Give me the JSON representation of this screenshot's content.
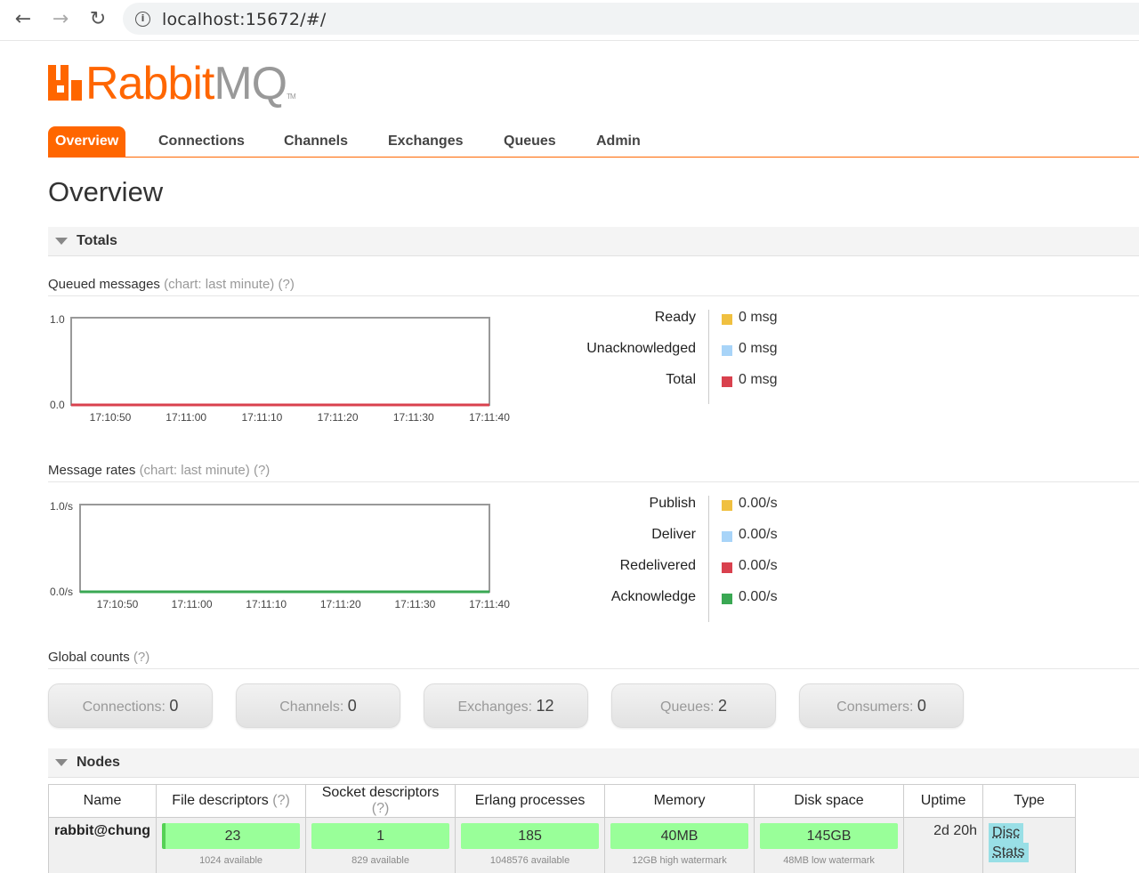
{
  "browser": {
    "url": "localhost:15672/#/"
  },
  "logo": {
    "brand_rabbit": "Rabbit",
    "brand_mq": "MQ",
    "tm": "TM"
  },
  "tabs": [
    {
      "label": "Overview",
      "active": true
    },
    {
      "label": "Connections"
    },
    {
      "label": "Channels"
    },
    {
      "label": "Exchanges"
    },
    {
      "label": "Queues"
    },
    {
      "label": "Admin"
    }
  ],
  "page_title": "Overview",
  "totals": {
    "header": "Totals",
    "queued": {
      "title": "Queued messages",
      "chart_note": "(chart: last minute)",
      "help": "(?)",
      "legend": [
        {
          "label": "Ready",
          "value": "0 msg",
          "color": "#f0c040"
        },
        {
          "label": "Unacknowledged",
          "value": "0 msg",
          "color": "#a8d4f8"
        },
        {
          "label": "Total",
          "value": "0 msg",
          "color": "#d9414e"
        }
      ]
    },
    "rates": {
      "title": "Message rates",
      "chart_note": "(chart: last minute)",
      "help": "(?)",
      "legend": [
        {
          "label": "Publish",
          "value": "0.00/s",
          "color": "#f0c040"
        },
        {
          "label": "Deliver",
          "value": "0.00/s",
          "color": "#a8d4f8"
        },
        {
          "label": "Redelivered",
          "value": "0.00/s",
          "color": "#d9414e"
        },
        {
          "label": "Acknowledge",
          "value": "0.00/s",
          "color": "#3aa853"
        }
      ]
    },
    "global_counts": {
      "title": "Global counts",
      "help": "(?)",
      "items": [
        {
          "label": "Connections:",
          "value": "0"
        },
        {
          "label": "Channels:",
          "value": "0"
        },
        {
          "label": "Exchanges:",
          "value": "12"
        },
        {
          "label": "Queues:",
          "value": "2"
        },
        {
          "label": "Consumers:",
          "value": "0"
        }
      ]
    }
  },
  "chart_data": [
    {
      "type": "line",
      "x": [
        "17:10:50",
        "17:11:00",
        "17:11:10",
        "17:11:20",
        "17:11:30",
        "17:11:40"
      ],
      "series": [
        {
          "name": "Ready",
          "values": [
            0,
            0,
            0,
            0,
            0,
            0
          ]
        },
        {
          "name": "Unacknowledged",
          "values": [
            0,
            0,
            0,
            0,
            0,
            0
          ]
        },
        {
          "name": "Total",
          "values": [
            0,
            0,
            0,
            0,
            0,
            0
          ]
        }
      ],
      "ylim": [
        0,
        1
      ],
      "yticks": [
        "0.0",
        "1.0"
      ]
    },
    {
      "type": "line",
      "x": [
        "17:10:50",
        "17:11:00",
        "17:11:10",
        "17:11:20",
        "17:11:30",
        "17:11:40"
      ],
      "series": [
        {
          "name": "Publish",
          "values": [
            0,
            0,
            0,
            0,
            0,
            0
          ]
        },
        {
          "name": "Deliver",
          "values": [
            0,
            0,
            0,
            0,
            0,
            0
          ]
        },
        {
          "name": "Redelivered",
          "values": [
            0,
            0,
            0,
            0,
            0,
            0
          ]
        },
        {
          "name": "Acknowledge",
          "values": [
            0,
            0,
            0,
            0,
            0,
            0
          ]
        }
      ],
      "ylim": [
        0,
        1
      ],
      "yticks": [
        "0.0/s",
        "1.0/s"
      ]
    }
  ],
  "nodes": {
    "header": "Nodes",
    "columns": [
      "Name",
      "File descriptors",
      "Socket descriptors",
      "Erlang processes",
      "Memory",
      "Disk space",
      "Uptime",
      "Type"
    ],
    "help": "(?)",
    "row": {
      "name": "rabbit@chung",
      "file_descriptors": {
        "value": "23",
        "sub": "1024 available",
        "fraction": 0.022
      },
      "socket_descriptors": {
        "value": "1",
        "sub": "829 available"
      },
      "erlang_processes": {
        "value": "185",
        "sub": "1048576 available"
      },
      "memory": {
        "value": "40MB",
        "sub": "12GB high watermark"
      },
      "disk_space": {
        "value": "145GB",
        "sub": "48MB low watermark"
      },
      "uptime": "2d 20h",
      "types": [
        "Disc",
        "Stats"
      ]
    }
  }
}
